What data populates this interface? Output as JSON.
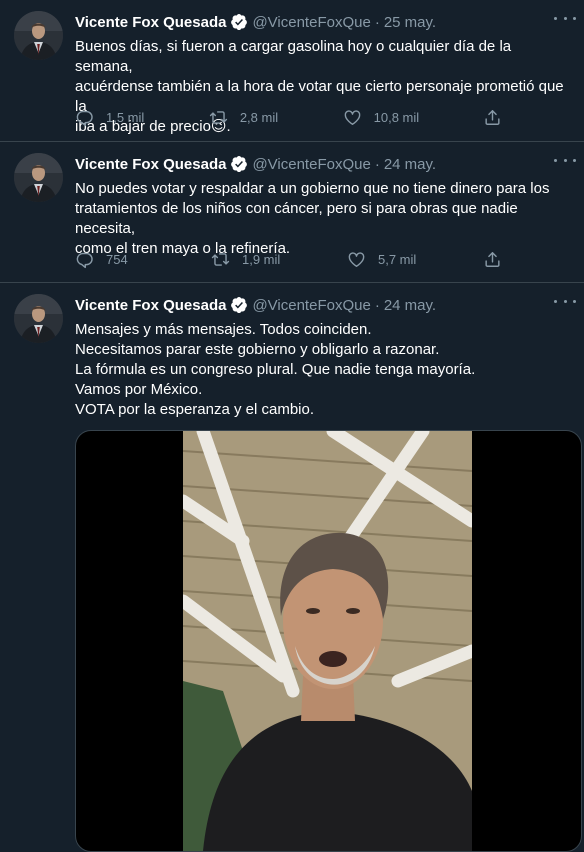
{
  "tweets": [
    {
      "name": "Vicente Fox Quesada",
      "handle": "@VicenteFoxQue",
      "separator": "·",
      "date": "25 may.",
      "text_lines": [
        "Buenos días, si fueron a cargar gasolina hoy o cualquier día de la semana,",
        "acuérdense también a la hora de votar que cierto personaje prometió que la",
        "iba a bajar de precio😉."
      ],
      "replies": "1,5 mil",
      "retweets": "2,8 mil",
      "likes": "10,8 mil"
    },
    {
      "name": "Vicente Fox Quesada",
      "handle": "@VicenteFoxQue",
      "separator": "·",
      "date": "24 may.",
      "text_lines": [
        "No puedes votar y respaldar a un gobierno que no tiene dinero para los",
        "tratamientos de los niños con cáncer, pero si para obras que nadie necesita,",
        "como el tren maya o la refinería."
      ],
      "replies": "754",
      "retweets": "1,9 mil",
      "likes": "5,7 mil"
    },
    {
      "name": "Vicente Fox Quesada",
      "handle": "@VicenteFoxQue",
      "separator": "·",
      "date": "24 may.",
      "text_lines": [
        "Mensajes y más mensajes. Todos coinciden.",
        "Necesitamos parar este gobierno y obligarlo a razonar.",
        "La fórmula es un congreso plural. Que nadie tenga mayoría.",
        "Vamos por México.",
        "VOTA por la esperanza y el cambio."
      ],
      "media": "video"
    }
  ],
  "icons": {
    "reply": "reply-icon",
    "retweet": "retweet-icon",
    "like": "heart-icon",
    "share": "share-icon",
    "verified": "verified-badge-icon",
    "more": "more-icon"
  },
  "colors": {
    "background": "#15202b",
    "border": "#38444d",
    "muted": "#8899a6",
    "accent": "#1da1f2"
  }
}
